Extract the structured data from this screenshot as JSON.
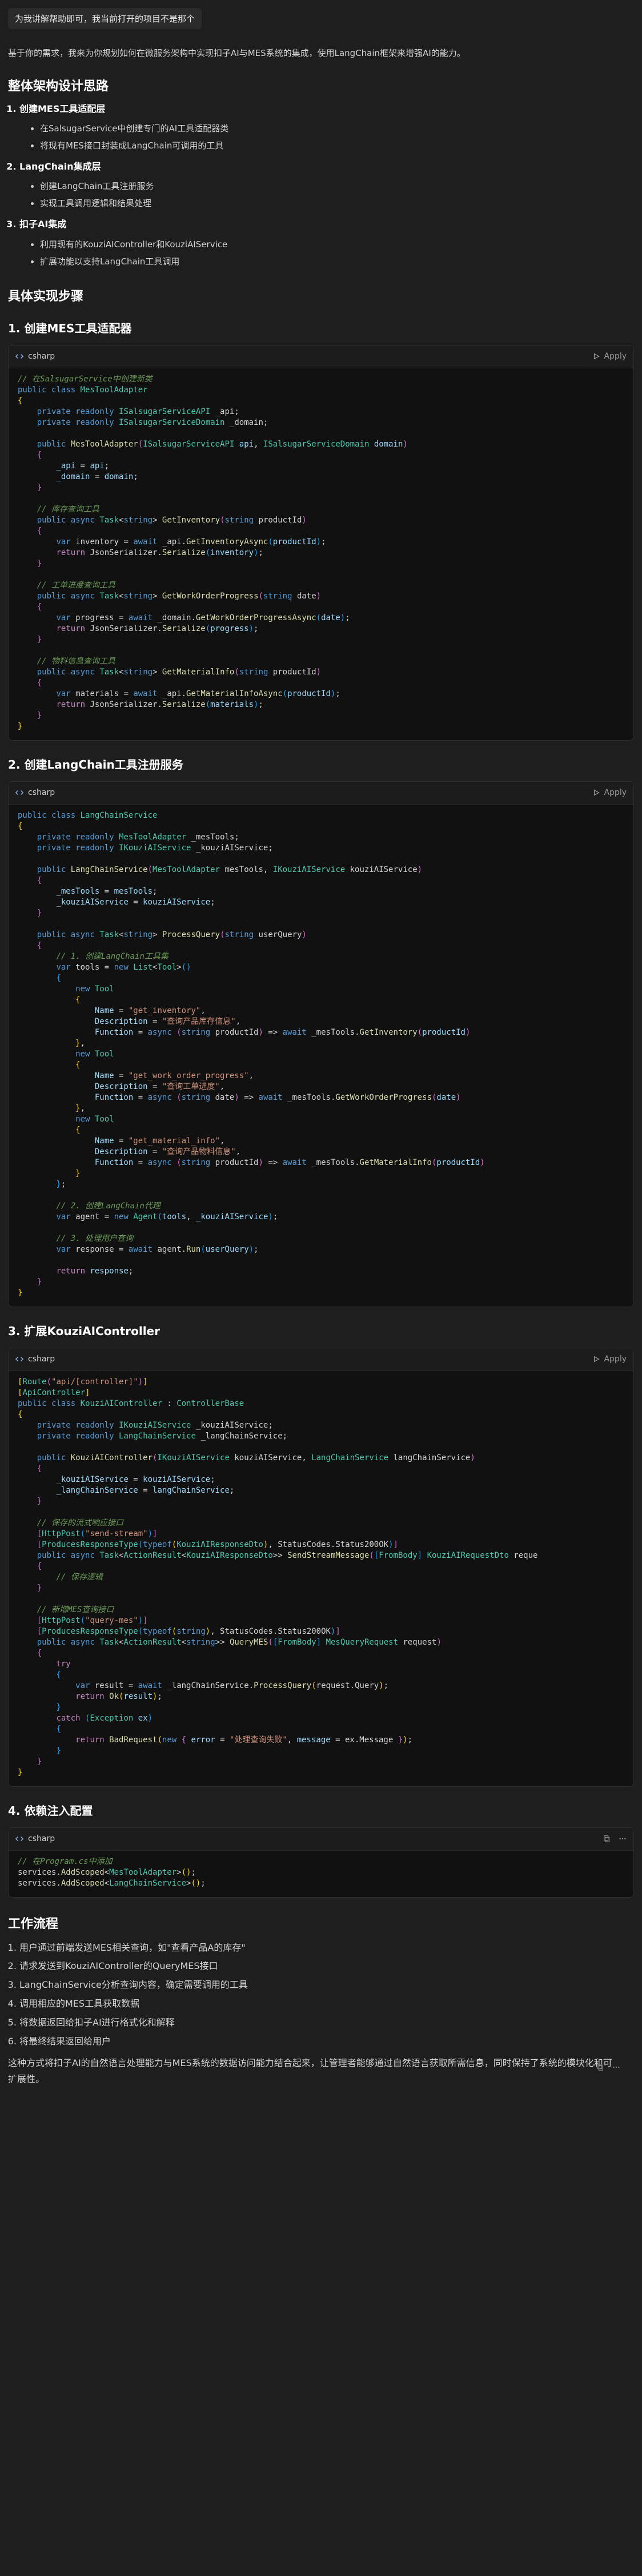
{
  "user_message": "为我讲解帮助即可，我当前打开的项目不是那个",
  "intro": "基于你的需求，我来为你规划如何在微服务架构中实现扣子AI与MES系统的集成，使用LangChain框架来增强AI的能力。",
  "architecture": {
    "title": "整体架构设计思路",
    "items": [
      {
        "label": "创建MES工具适配层",
        "bullets": [
          "在SalsugarService中创建专门的AI工具适配器类",
          "将现有MES接口封装成LangChain可调用的工具"
        ]
      },
      {
        "label": "LangChain集成层",
        "bullets": [
          "创建LangChain工具注册服务",
          "实现工具调用逻辑和结果处理"
        ]
      },
      {
        "label": "扣子AI集成",
        "bullets": [
          "利用现有的KouziAIController和KouziAIService",
          "扩展功能以支持LangChain工具调用"
        ]
      }
    ]
  },
  "steps": {
    "title": "具体实现步骤",
    "sections": [
      {
        "title": "1. 创建MES工具适配器",
        "lang": "csharp",
        "apply": "Apply"
      },
      {
        "title": "2. 创建LangChain工具注册服务",
        "lang": "csharp",
        "apply": "Apply"
      },
      {
        "title": "3. 扩展KouziAIController",
        "lang": "csharp",
        "apply": "Apply"
      },
      {
        "title": "4. 依赖注入配置",
        "lang": "csharp",
        "apply": ""
      }
    ]
  },
  "workflow": {
    "title": "工作流程",
    "items": [
      "用户通过前端发送MES相关查询，如\"查看产品A的库存\"",
      "请求发送到KouziAIController的QueryMES接口",
      "LangChainService分析查询内容，确定需要调用的工具",
      "调用相应的MES工具获取数据",
      "将数据返回给扣子AI进行格式化和解释",
      "将最终结果返回给用户"
    ],
    "summary": "这种方式将扣子AI的自然语言处理能力与MES系统的数据访问能力结合起来，让管理者能够通过自然语言获取所需信息，同时保持了系统的模块化和可扩展性。"
  }
}
